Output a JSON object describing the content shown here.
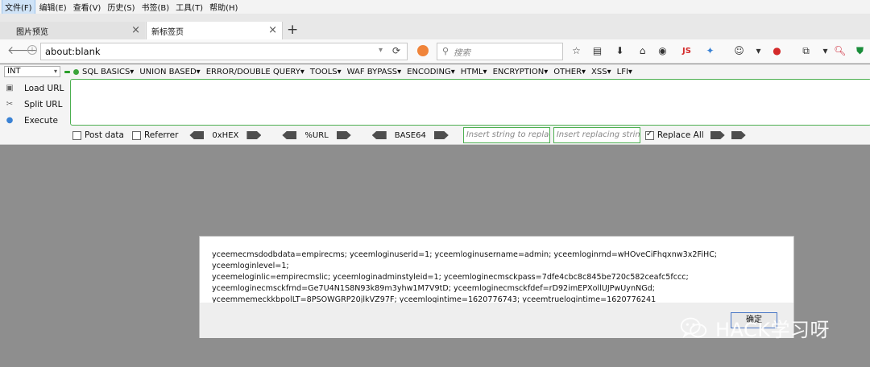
{
  "menubar": [
    "文件(F)",
    "编辑(E)",
    "查看(V)",
    "历史(S)",
    "书签(B)",
    "工具(T)",
    "帮助(H)"
  ],
  "tabs": [
    {
      "title": "图片预览"
    },
    {
      "title": "新标签页"
    }
  ],
  "navbar": {
    "url": "about:blank",
    "search_placeholder": "搜索"
  },
  "hackbar": {
    "select_value": "INT",
    "menus": [
      "SQL BASICS▾",
      "UNION BASED▾",
      "ERROR/DOUBLE QUERY▾",
      "TOOLS▾",
      "WAF BYPASS▾",
      "ENCODING▾",
      "HTML▾",
      "ENCRYPTION▾",
      "OTHER▾",
      "XSS▾",
      "LFI▾"
    ],
    "actions": {
      "load": "Load URL",
      "split": "Split URL",
      "execute": "Execute"
    },
    "post_data": "Post data",
    "referrer": "Referrer",
    "hex": "0xHEX",
    "url_enc": "%URL",
    "base64": "BASE64",
    "insert_placeholder": "Insert string to replace",
    "replacing_placeholder": "Insert replacing string",
    "replace_all": "Replace All"
  },
  "dialog": {
    "message_lines": [
      "yceemecmsdodbdata=empirecms; yceemloginuserid=1; yceemloginusername=admin; yceemloginrnd=wHOveCiFhqxnw3x2FiHC; yceemloginlevel=1;",
      "yceemeloginlic=empirecmslic; yceemloginadminstyleid=1; yceemloginecmsckpass=7dfe4cbc8c845be720c582ceafc5fccc;",
      "yceemloginecmsckfrnd=Ge7U4N1S8N93k89m3yhw1M7V9tD; yceemloginecmsckfdef=rD92imEPXollUJPwUynNGd;",
      "yceemmemeckkbpolLT=8PSOWGRP20jlkVZ97F; yceemlogintime=1620776743; yceemtruelogintime=1620776241"
    ],
    "ok_label": "确定"
  },
  "watermark": {
    "text": "HACK学习呀"
  },
  "colors": {
    "accent_green": "#4caf50",
    "page_bg": "#8e8e8e"
  }
}
